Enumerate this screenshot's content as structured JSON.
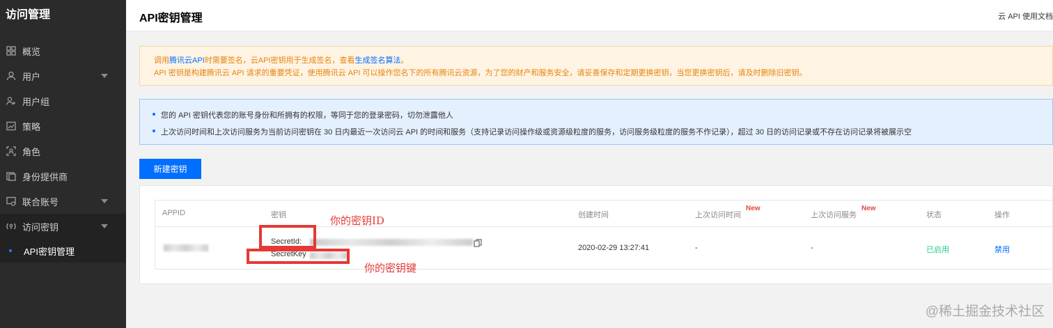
{
  "sidebar": {
    "title": "访问管理",
    "items": [
      {
        "label": "概览",
        "icon": "grid-icon"
      },
      {
        "label": "用户",
        "icon": "user-icon",
        "has_caret": true
      },
      {
        "label": "用户组",
        "icon": "user-group-icon"
      },
      {
        "label": "策略",
        "icon": "policy-icon"
      },
      {
        "label": "角色",
        "icon": "role-icon"
      },
      {
        "label": "身份提供商",
        "icon": "identity-provider-icon"
      },
      {
        "label": "联合账号",
        "icon": "federated-account-icon",
        "has_caret": true
      },
      {
        "label": "访问密钥",
        "icon": "access-key-icon",
        "has_caret": true
      }
    ],
    "sub_item": "API密钥管理"
  },
  "header": {
    "title": "API密钥管理",
    "doc_link": "云 API 使用文档"
  },
  "warning": {
    "line1_prefix": "调用",
    "line1_link1": "腾讯云API",
    "line1_mid": "时需要签名，云API密钥用于生成签名，查看",
    "line1_link2": "生成签名算法",
    "line1_suffix": "。",
    "line2": "API 密钥是构建腾讯云 API 请求的重要凭证，使用腾讯云 API 可以操作您名下的所有腾讯云资源，为了您的财产和服务安全，请妥善保存和定期更换密钥，当您更换密钥后，请及时删除旧密钥。"
  },
  "info": {
    "line1": "您的 API 密钥代表您的账号身份和所拥有的权限，等同于您的登录密码，切勿泄露他人",
    "line2": "上次访问时间和上次访问服务为当前访问密钥在 30 日内最近一次访问云 API 的时间和服务（支持记录访问操作级或资源级粒度的服务，访问服务级粒度的服务不作记录），超过 30 日的访问记录或不存在访问记录将被展示空"
  },
  "create_button": "新建密钥",
  "table": {
    "headers": {
      "appid": "APPID",
      "key": "密钥",
      "created": "创建时间",
      "last_access_time": "上次访问时间",
      "last_access_service": "上次访问服务",
      "status": "状态",
      "action": "操作",
      "new_tag": "New"
    },
    "row": {
      "secret_id_label": "SecretId:",
      "secret_key_label": "SecretKey",
      "created": "2020-02-29 13:27:41",
      "last_access_time": "-",
      "last_access_service": "-",
      "status": "已启用",
      "action": "禁用"
    }
  },
  "annotations": {
    "secret_id": "你的密钥ID",
    "secret_key": "你的密钥键"
  },
  "watermark": "@稀土掘金技术社区",
  "colors": {
    "primary": "#006eff",
    "sidebar_bg": "#2b2b2b",
    "warning_text": "#e5840e",
    "status_ok": "#29cc85",
    "annotation": "#e53935"
  }
}
